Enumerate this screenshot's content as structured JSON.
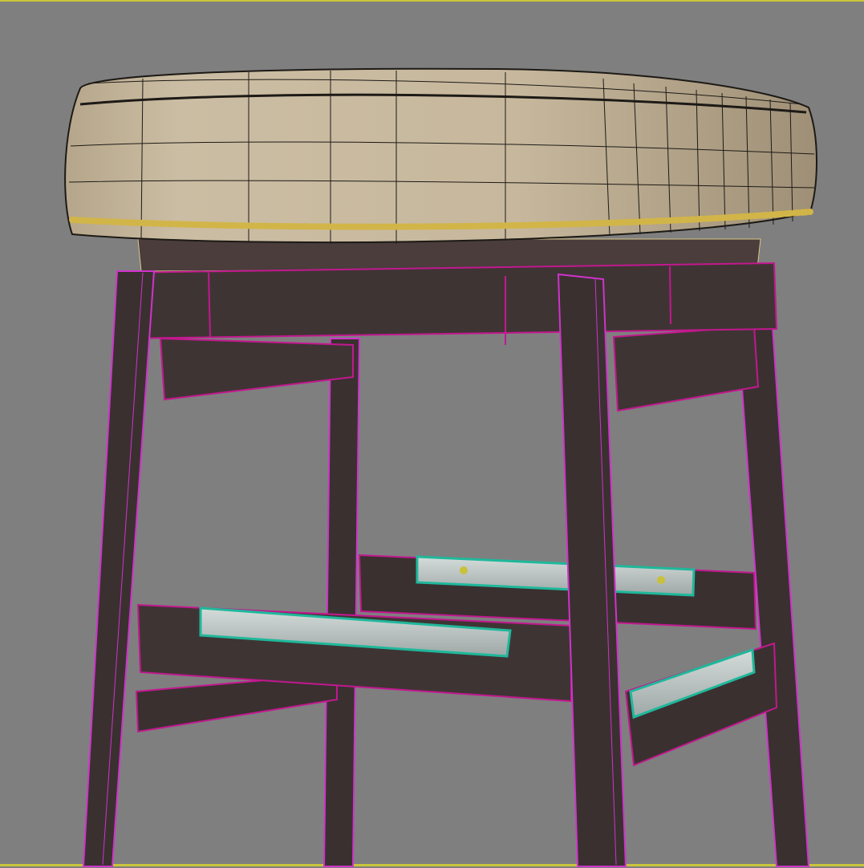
{
  "viewport": {
    "background": "#7f7f7f",
    "frame_border": "#c9c63a"
  },
  "scene": {
    "subject": "bar-stool",
    "colors": {
      "cushion_light": "#c8b9a0",
      "cushion_mid": "#b3a387",
      "cushion_dark": "#8f8069",
      "wireframe": "#1d1a16",
      "nailhead": "#d2b548",
      "wood": "#3a3030",
      "wood_light": "#4a3d3c",
      "wood_edge": "#c2188f",
      "leg_edge": "#d033cc",
      "footrest_metal": "#b9c4c2",
      "footrest_edge": "#1fb89b"
    }
  }
}
